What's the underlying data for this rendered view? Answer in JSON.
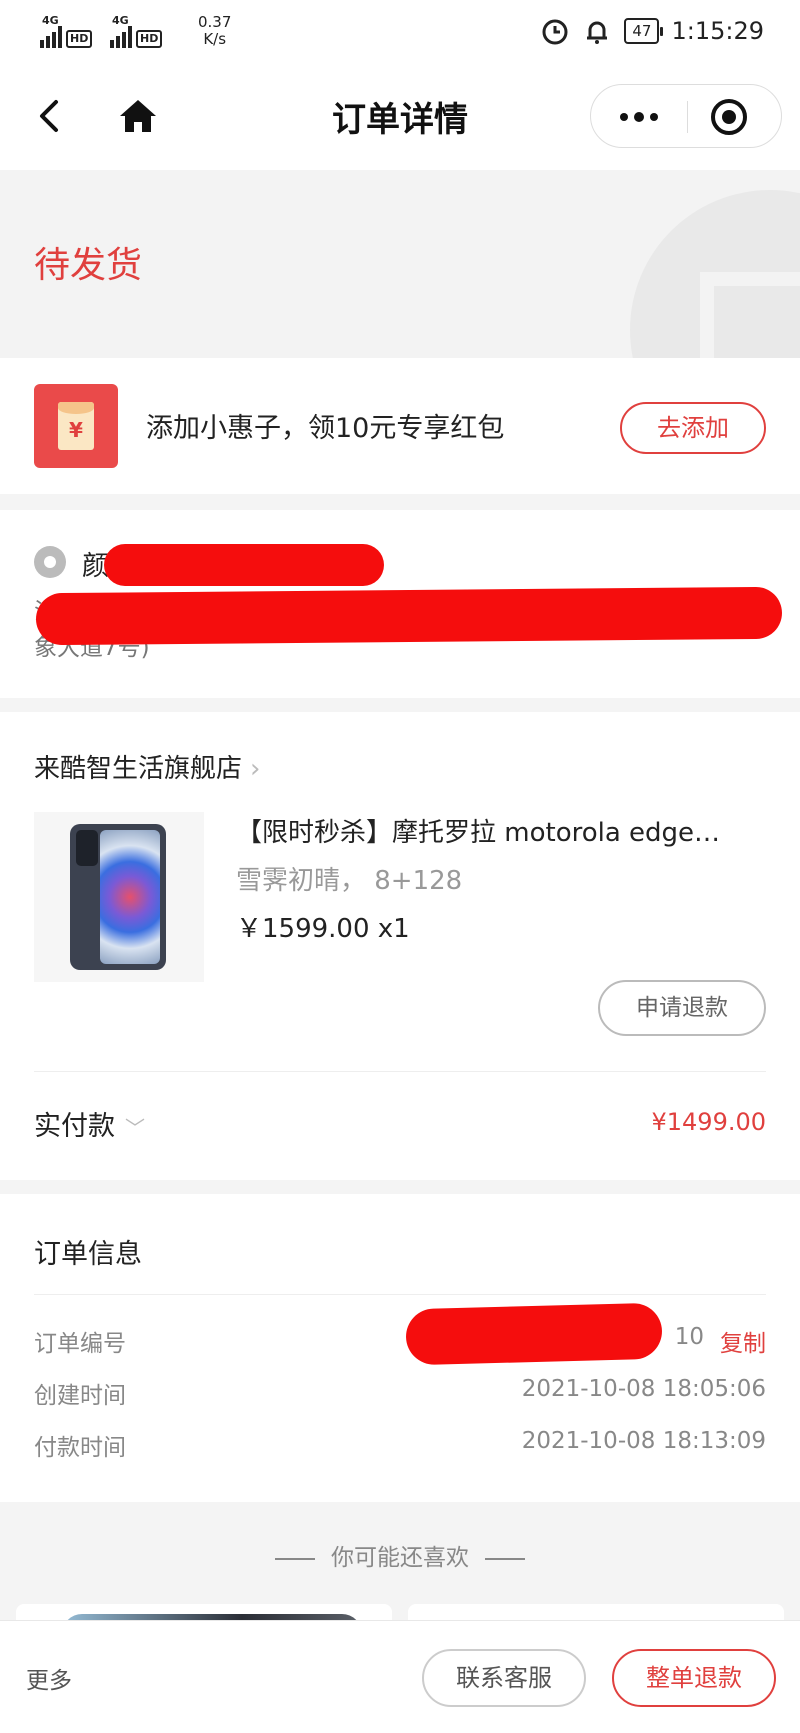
{
  "status_bar": {
    "network1": "4G",
    "network2": "4G",
    "hd": "HD",
    "speed_value": "0.37",
    "speed_unit": "K/s",
    "battery": "47",
    "time": "1:15:29"
  },
  "nav": {
    "title": "订单详情"
  },
  "order_status": {
    "text": "待发货"
  },
  "promo": {
    "icon_glyph": "¥",
    "text": "添加小惠子，领10元专享红包",
    "button": "去添加"
  },
  "address": {
    "name_visible": "颜",
    "line1_visible": "江西",
    "line2_visible": "象大道7号)"
  },
  "store": {
    "name": "来酷智生活旗舰店",
    "chevron": "›",
    "product": {
      "title": "【限时秒杀】摩托罗拉 motorola edge…",
      "spec": "雪霁初晴， 8+128",
      "price": "￥1599.00  x1"
    },
    "refund_button": "申请退款",
    "paid_label": "实付款",
    "paid_amount": "¥1499.00"
  },
  "order_info": {
    "title": "订单信息",
    "order_no_label": "订单编号",
    "order_no_tail": "10",
    "copy": "复制",
    "created_label": "创建时间",
    "created_value": "2021-10-08 18:05:06",
    "paid_label": "付款时间",
    "paid_value": "2021-10-08 18:13:09"
  },
  "recommend": {
    "heading": "你可能还喜欢"
  },
  "bottom_bar": {
    "more": "更多",
    "service": "联系客服",
    "refund_all": "整单退款"
  },
  "colors": {
    "accent": "#e0403e",
    "redaction": "#f50d0d"
  },
  "icons": [
    "back-arrow-icon",
    "home-icon",
    "more-dots-icon",
    "target-icon",
    "red-packet-icon",
    "location-pin-icon",
    "chevron-right-icon",
    "chevron-down-icon"
  ]
}
